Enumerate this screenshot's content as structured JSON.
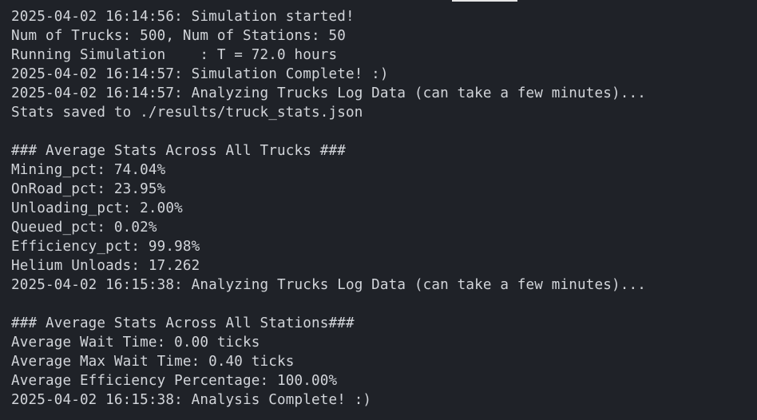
{
  "terminal": {
    "lines": [
      "2025-04-02 16:14:56: Simulation started!",
      "Num of Trucks: 500, Num of Stations: 50",
      "Running Simulation    : T = 72.0 hours",
      "2025-04-02 16:14:57: Simulation Complete! :)",
      "2025-04-02 16:14:57: Analyzing Trucks Log Data (can take a few minutes)...",
      "Stats saved to ./results/truck_stats.json",
      "",
      "### Average Stats Across All Trucks ###",
      "Mining_pct: 74.04%",
      "OnRoad_pct: 23.95%",
      "Unloading_pct: 2.00%",
      "Queued_pct: 0.02%",
      "Efficiency_pct: 99.98%",
      "Helium Unloads: 17.262",
      "2025-04-02 16:15:38: Analyzing Trucks Log Data (can take a few minutes)...",
      "",
      "### Average Stats Across All Stations###",
      "Average Wait Time: 0.00 ticks",
      "Average Max Wait Time: 0.40 ticks",
      "Average Efficiency Percentage: 100.00%",
      "2025-04-02 16:15:38: Analysis Complete! :)"
    ]
  },
  "colors": {
    "background": "#1f2228",
    "text": "#d2d5da"
  }
}
